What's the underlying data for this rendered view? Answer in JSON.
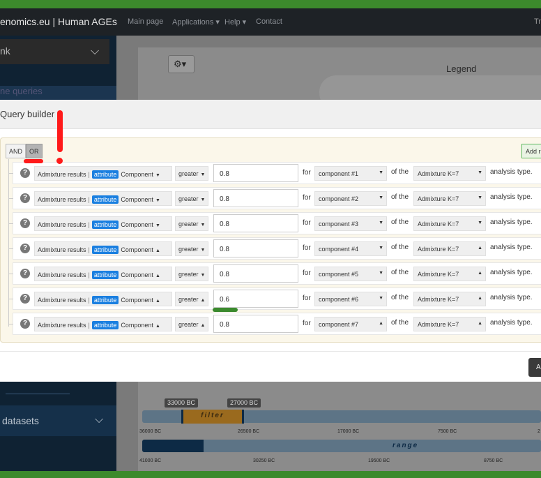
{
  "navbar": {
    "brand": "enomics.eu  |  Human AGEs",
    "items": [
      "Main page",
      "Applications ▾",
      "Help ▾",
      "Contact"
    ],
    "right_text": "Tr"
  },
  "sidebar": {
    "select_value": "nk",
    "section_label": "ne queries",
    "datasets_label": "datasets"
  },
  "map": {
    "legend_label": "Legend"
  },
  "timeline": {
    "filter_start_badge": "33000 BC",
    "filter_end_badge": "27000 BC",
    "filter_label": "filter",
    "range_label": "range",
    "top_ticks": [
      "36000 BC",
      "26500 BC",
      "17000 BC",
      "7500 BC",
      "2"
    ],
    "bottom_ticks": [
      "41000 BC",
      "30250 BC",
      "19500 BC",
      "8750 BC"
    ]
  },
  "modal": {
    "title": "Query builder",
    "condition_and": "AND",
    "condition_or": "OR",
    "add_rule_label": "Add r",
    "footer_button_label": "A",
    "rules": [
      {
        "source": "Admixture results",
        "attribute_badge": "attribute",
        "attribute": "Component",
        "operator": "greater",
        "value": "0.8",
        "for_label": "for",
        "component": "component #1",
        "of_the_label": "of the",
        "analysis": "Admixture K=7",
        "type_label": "analysis type."
      },
      {
        "source": "Admixture results",
        "attribute_badge": "attribute",
        "attribute": "Component",
        "operator": "greater",
        "value": "0.8",
        "for_label": "for",
        "component": "component #2",
        "of_the_label": "of the",
        "analysis": "Admixture K=7",
        "type_label": "analysis type."
      },
      {
        "source": "Admixture results",
        "attribute_badge": "attribute",
        "attribute": "Component",
        "operator": "greater",
        "value": "0.8",
        "for_label": "for",
        "component": "component #3",
        "of_the_label": "of the",
        "analysis": "Admixture K=7",
        "type_label": "analysis type."
      },
      {
        "source": "Admixture results",
        "attribute_badge": "attribute",
        "attribute": "Component",
        "operator": "greater",
        "value": "0.8",
        "for_label": "for",
        "component": "component #4",
        "of_the_label": "of the",
        "analysis": "Admixture K=7",
        "type_label": "analysis type."
      },
      {
        "source": "Admixture results",
        "attribute_badge": "attribute",
        "attribute": "Component",
        "operator": "greater",
        "value": "0.8",
        "for_label": "for",
        "component": "component #5",
        "of_the_label": "of the",
        "analysis": "Admixture K=7",
        "type_label": "analysis type."
      },
      {
        "source": "Admixture results",
        "attribute_badge": "attribute",
        "attribute": "Component",
        "operator": "greater",
        "value": "0.6",
        "for_label": "for",
        "component": "component #6",
        "of_the_label": "of the",
        "analysis": "Admixture K=7",
        "type_label": "analysis type."
      },
      {
        "source": "Admixture results",
        "attribute_badge": "attribute",
        "attribute": "Component",
        "operator": "greater",
        "value": "0.8",
        "for_label": "for",
        "component": "component #7",
        "of_the_label": "of the",
        "analysis": "Admixture K=7",
        "type_label": "analysis type."
      }
    ]
  },
  "colors": {
    "frame_green": "#3c8a2c",
    "navbar": "#1e2226",
    "attribute_badge": "#1a7fe0",
    "annotation_red": "#ff1a1a",
    "annotation_green": "#3b8a2e"
  }
}
